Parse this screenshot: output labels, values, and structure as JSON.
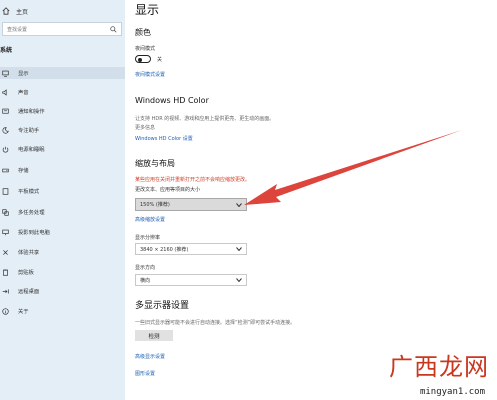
{
  "sidebar": {
    "home_label": "主页",
    "search_placeholder": "查找设置",
    "section_title": "系统",
    "items": [
      {
        "label": "显示",
        "icon": "monitor-icon"
      },
      {
        "label": "声音",
        "icon": "speaker-icon"
      },
      {
        "label": "通知和操作",
        "icon": "notification-icon"
      },
      {
        "label": "专注助手",
        "icon": "moon-icon"
      },
      {
        "label": "电源和睡眠",
        "icon": "power-icon"
      },
      {
        "label": "存储",
        "icon": "storage-icon"
      },
      {
        "label": "平板模式",
        "icon": "tablet-icon"
      },
      {
        "label": "多任务处理",
        "icon": "multitask-icon"
      },
      {
        "label": "投影到此电脑",
        "icon": "project-icon"
      },
      {
        "label": "体验共享",
        "icon": "share-icon"
      },
      {
        "label": "剪贴板",
        "icon": "clipboard-icon"
      },
      {
        "label": "远程桌面",
        "icon": "remote-icon"
      },
      {
        "label": "关于",
        "icon": "info-icon"
      }
    ]
  },
  "main": {
    "title": "显示",
    "color": {
      "heading": "颜色",
      "night_light_label": "夜间模式",
      "toggle_state": "关",
      "night_light_link": "夜间模式设置"
    },
    "hdr": {
      "heading": "Windows HD Color",
      "description_1": "让支持 HDR 的视频、游戏和应用上提供更亮、更生动的画面。",
      "description_2": "更多信息",
      "link": "Windows HD Color 设置"
    },
    "scale": {
      "heading": "缩放与布局",
      "warning": "某些应用在关闭并重新打开之前不会响应缩放更改。",
      "label": "更改文本、应用等项目的大小",
      "value": "150% (推荐)",
      "advanced_link": "高级缩放设置",
      "resolution_label": "显示分辨率",
      "resolution_value": "3840 × 2160 (推荐)",
      "orientation_label": "显示方向",
      "orientation_value": "横向"
    },
    "multi": {
      "heading": "多显示器设置",
      "description": "一些旧式显示器可能不会进行自动连接。选择“检测”即可尝试手动连接。",
      "detect_button": "检测",
      "link_advanced": "高级显示设置",
      "link_graphics": "图形设置"
    }
  },
  "watermark": {
    "chinese": "广西龙网",
    "url": "mingyan1.com"
  },
  "colors": {
    "sidebar_bg": "#e4eef6",
    "link": "#1a5fb4",
    "warning": "#d0402a",
    "arrow": "#d9342b"
  }
}
